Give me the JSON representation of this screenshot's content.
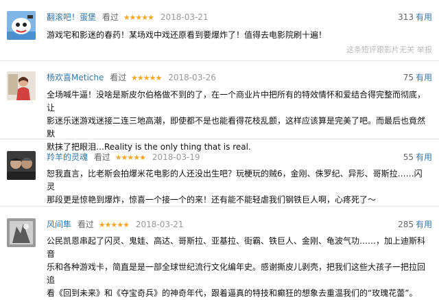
{
  "reviews": [
    {
      "user": "翻滚吧！蛋堡",
      "seen": "看过",
      "stars": "★★★★★",
      "date": "2018-03-21",
      "votes": "313",
      "useful": "有用",
      "text": "游戏宅和影迷的春药！某场戏中戏还原看到要爆炸了！值得去电影院刷十遍！",
      "meta": "这条短评跟影片无关",
      "report": "举报"
    },
    {
      "user": "杨欢喜Metiche",
      "seen": "看过",
      "stars": "★★★★★",
      "date": "2018-03-26",
      "votes": "75",
      "useful": "有用",
      "text_lines": [
        "全场喊牛逼！没啥是斯皮尔伯格做不到的了，在一个商业片中把所有的特效情怀和爱结合得完整而彻底，让",
        "影迷乐迷游戏迷接二连三地高潮，即使都不是也能看得花枝乱颤，这样应该算是完美了吧。而最后也竟然默",
        "默抹了把眼泪…Reality is the only thing that is real."
      ]
    },
    {
      "user": "羚羊的灵魂",
      "seen": "看过",
      "stars": "★★★★★",
      "date": "2018-03-19",
      "votes": "55",
      "useful": "有用",
      "text_lines": [
        "恕我直言，比老斯会拍爆米花电影的人还没出生吧？玩梗玩的贼6，金刚、侏罗纪、异形、哥斯拉……闪灵",
        "那段更是惊艳到爆炸，惊喜一个接一个的来！还有能不能轻虐我们钢铁巨人啊，心疼死了～"
      ]
    },
    {
      "user": "风间隼",
      "seen": "看过",
      "stars": "★★★★★",
      "date": "2018-03-21",
      "votes": "285",
      "useful": "有用",
      "text_lines": [
        "公民凯恩串起了闪灵、鬼娃、高达、哥斯拉、亚基拉、街霸、铁巨人、金刚、龟波气功……，加上迪斯科音",
        "乐和各种游戏卡，简直是是一部全球世纪流行文化编年史。感谢撕皮儿剥壳，把我们这些大孩子一把拉回追",
        "看《回到未来》和《夺宝奇兵》的神奇年代，跟着逼真的特技和癫狂的想象去重温我们的“玫瑰花蕾”。"
      ]
    }
  ]
}
